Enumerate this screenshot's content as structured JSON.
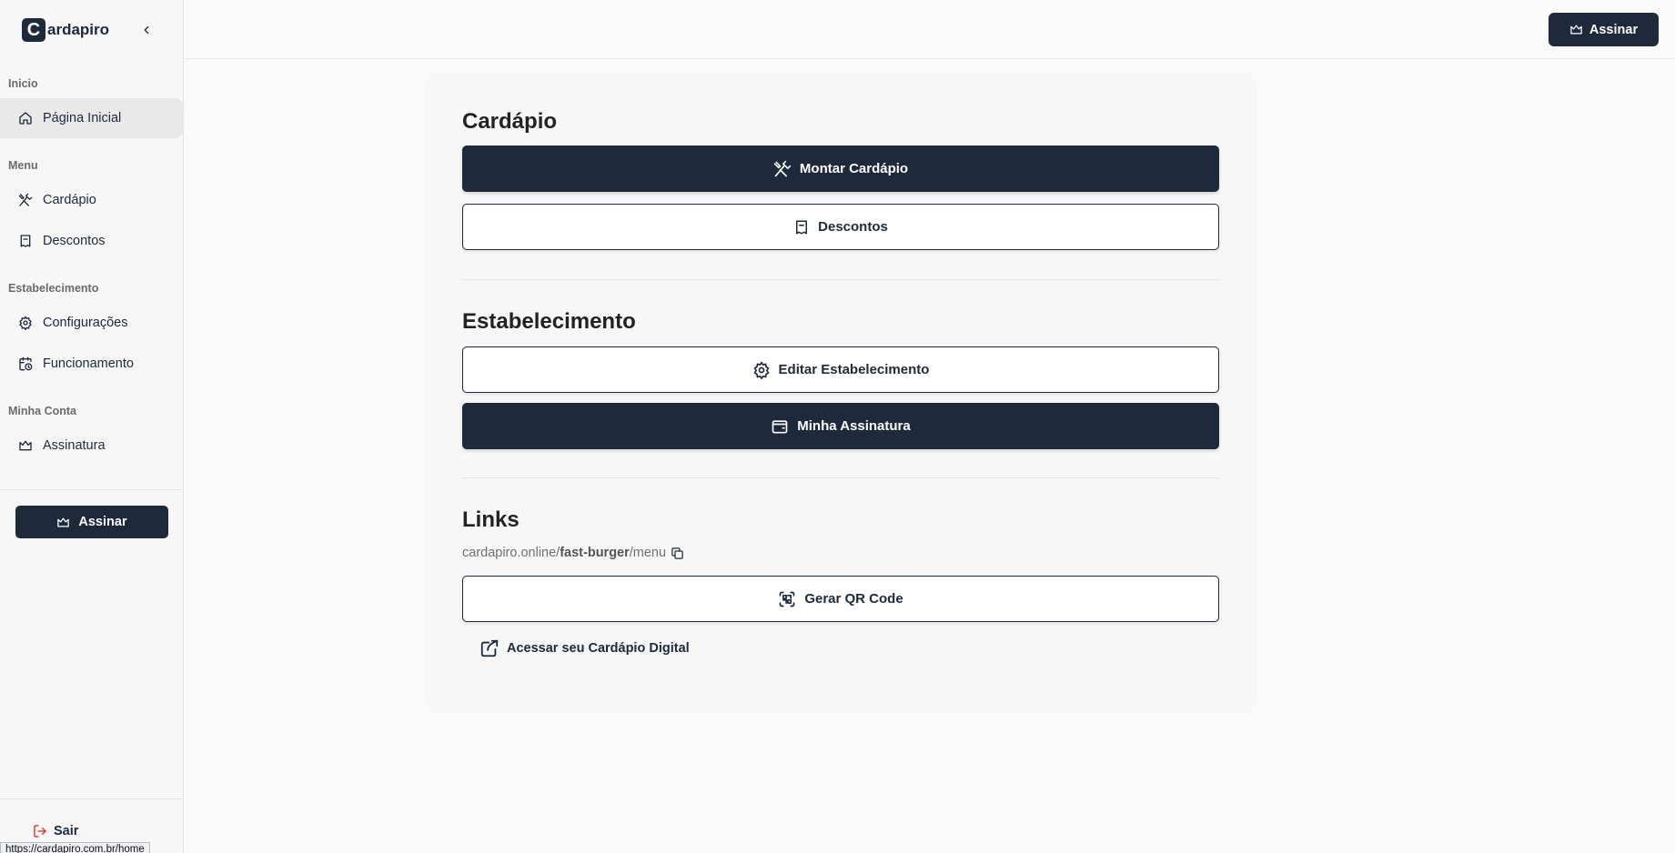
{
  "brand": {
    "mark": "C",
    "name": "ardapiro"
  },
  "sidebar": {
    "sections": [
      {
        "label": "Inicio"
      },
      {
        "label": "Menu"
      },
      {
        "label": "Estabelecimento"
      },
      {
        "label": "Minha Conta"
      }
    ],
    "items": [
      {
        "label": "Página Inicial",
        "icon": "home-icon",
        "active": true
      },
      {
        "label": "Cardápio",
        "icon": "utensils-crossed-icon"
      },
      {
        "label": "Descontos",
        "icon": "ticket-icon"
      },
      {
        "label": "Configurações",
        "icon": "gear-icon"
      },
      {
        "label": "Funcionamento",
        "icon": "calendar-clock-icon"
      },
      {
        "label": "Assinatura",
        "icon": "crown-icon"
      }
    ],
    "subscribe_label": "Assinar",
    "logout_label": "Sair"
  },
  "topbar": {
    "subscribe_label": "Assinar"
  },
  "main": {
    "menu_section": {
      "title": "Cardápio",
      "build_menu_label": "Montar Cardápio",
      "discounts_label": "Descontos"
    },
    "establishment_section": {
      "title": "Estabelecimento",
      "edit_label": "Editar Estabelecimento",
      "subscription_label": "Minha Assinatura"
    },
    "links_section": {
      "title": "Links",
      "url_prefix": "cardapiro.online/",
      "url_slug": "fast-burger",
      "url_suffix": "/menu",
      "qr_label": "Gerar QR Code",
      "access_label": "Acessar seu Cardápio Digital"
    }
  },
  "status_bar": {
    "url": "https://cardapiro.com.br/home"
  },
  "colors": {
    "primary": "#1e293b",
    "logout": "#dc2626",
    "background": "#fafafa"
  }
}
